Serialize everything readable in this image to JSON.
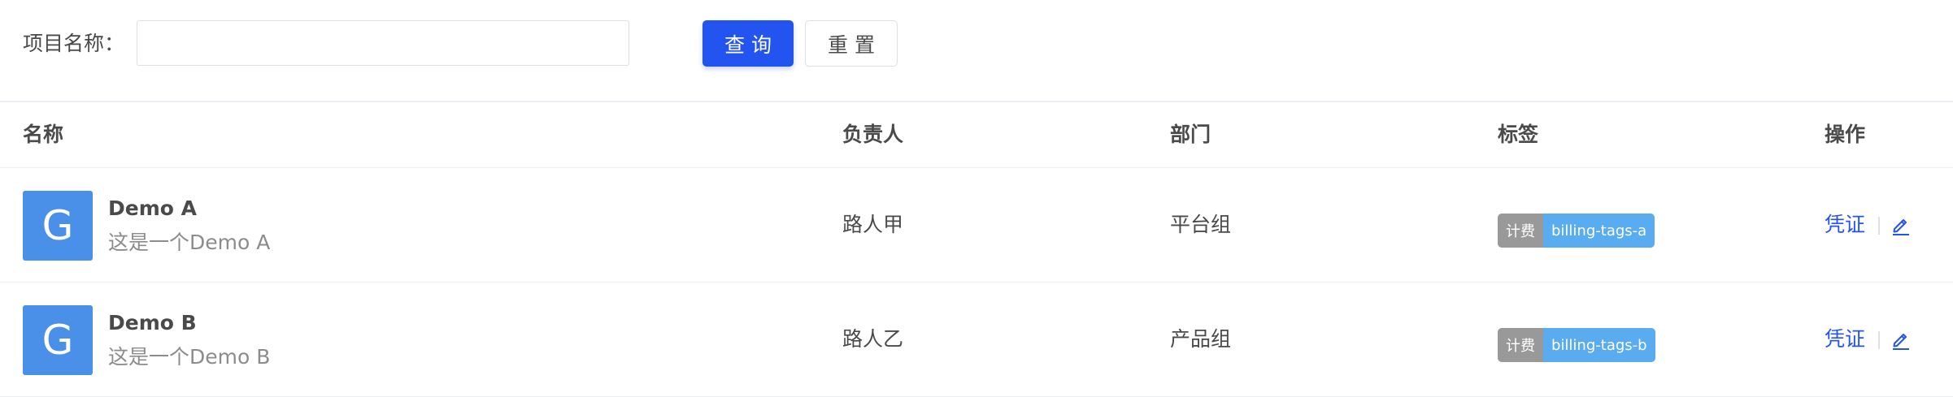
{
  "filter": {
    "label": "项目名称：",
    "input_value": "",
    "input_placeholder": "",
    "query_button": "查询",
    "reset_button": "重置"
  },
  "table": {
    "columns": [
      "名称",
      "负责人",
      "部门",
      "标签",
      "操作"
    ],
    "rows": [
      {
        "avatar_letter": "G",
        "name": "Demo A",
        "description": "这是一个Demo A",
        "owner": "路人甲",
        "department": "平台组",
        "tag_key": "计费",
        "tag_value": "billing-tags-a",
        "action_label": "凭证",
        "edit_icon": "pencil-edit-icon"
      },
      {
        "avatar_letter": "G",
        "name": "Demo B",
        "description": "这是一个Demo B",
        "owner": "路人乙",
        "department": "产品组",
        "tag_key": "计费",
        "tag_value": "billing-tags-b",
        "action_label": "凭证",
        "edit_icon": "pencil-edit-icon"
      }
    ]
  },
  "colors": {
    "primary": "#2454ef",
    "avatar_bg": "#4a8fe8",
    "tag_key_bg": "#999999",
    "tag_value_bg": "#5aacf0"
  }
}
